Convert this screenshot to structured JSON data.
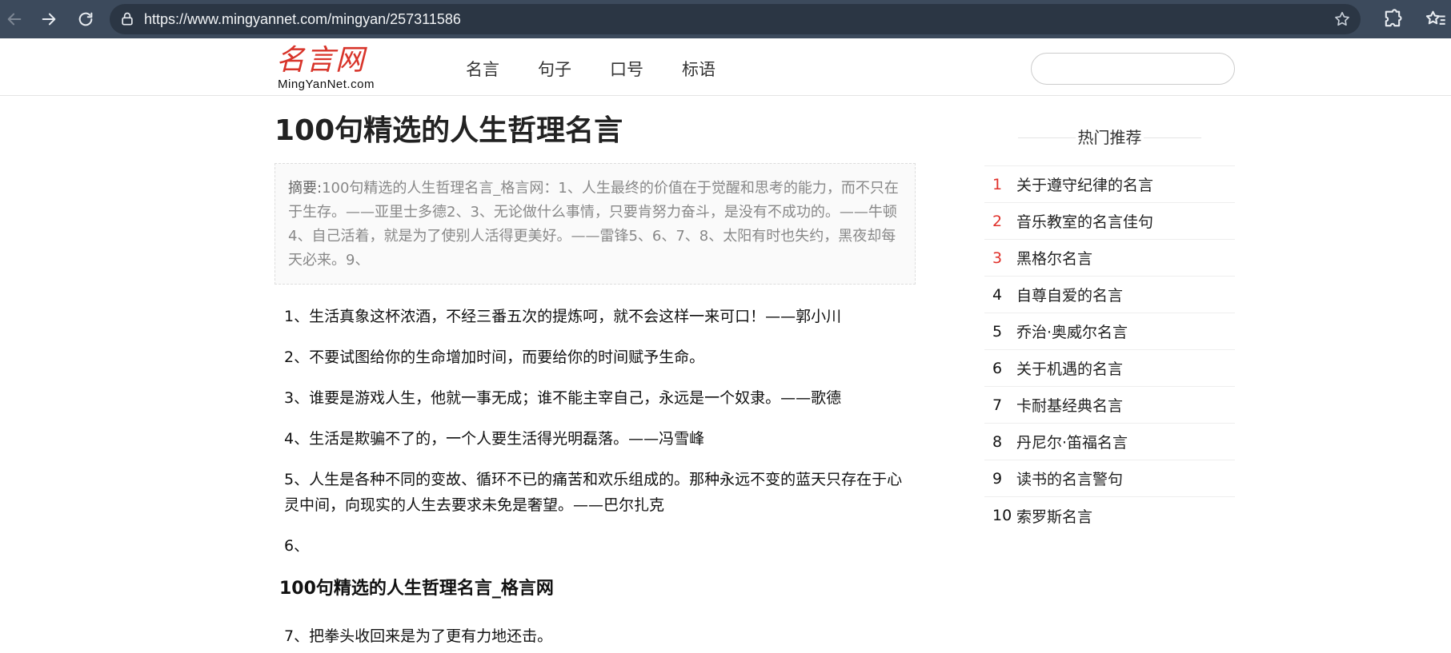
{
  "browser": {
    "url": "https://www.mingyannet.com/mingyan/257311586"
  },
  "site": {
    "logo_cn": "名言网",
    "logo_en": "MingYanNet.com",
    "nav": [
      "名言",
      "句子",
      "口号",
      "标语"
    ],
    "search_placeholder": ""
  },
  "article": {
    "title": "100句精选的人生哲理名言",
    "summary_label": "摘要:",
    "summary_text": "100句精选的人生哲理名言_格言网：1、人生最终的价值在于觉醒和思考的能力，而不只在于生存。——亚里士多德2、3、无论做什么事情，只要肯努力奋斗，是没有不成功的。——牛顿4、自己活着，就是为了使别人活得更美好。——雷锋5、6、7、8、太阳有时也失约，黑夜却每天必来。9、",
    "paragraphs": [
      "1、生活真象这杯浓酒，不经三番五次的提炼呵，就不会这样一来可口！——郭小川",
      "2、不要试图给你的生命增加时间，而要给你的时间赋予生命。",
      "3、谁要是游戏人生，他就一事无成；谁不能主宰自己，永远是一个奴隶。——歌德",
      "4、生活是欺骗不了的，一个人要生活得光明磊落。——冯雪峰",
      "5、人生是各种不同的变故、循环不已的痛苦和欢乐组成的。那种永远不变的蓝天只存在于心灵中间，向现实的人生去要求未免是奢望。——巴尔扎克",
      "6、"
    ],
    "subheading": "100句精选的人生哲理名言_格言网",
    "paragraphs_after": [
      "7、把拳头收回来是为了更有力地还击。"
    ]
  },
  "sidebar": {
    "title": "热门推荐",
    "items": [
      {
        "num": "1",
        "text": "关于遵守纪律的名言",
        "hot": true
      },
      {
        "num": "2",
        "text": "音乐教室的名言佳句",
        "hot": true
      },
      {
        "num": "3",
        "text": "黑格尔名言",
        "hot": true
      },
      {
        "num": "4",
        "text": "自尊自爱的名言",
        "hot": false
      },
      {
        "num": "5",
        "text": "乔治·奥威尔名言",
        "hot": false
      },
      {
        "num": "6",
        "text": "关于机遇的名言",
        "hot": false
      },
      {
        "num": "7",
        "text": "卡耐基经典名言",
        "hot": false
      },
      {
        "num": "8",
        "text": "丹尼尔·笛福名言",
        "hot": false
      },
      {
        "num": "9",
        "text": "读书的名言警句",
        "hot": false
      },
      {
        "num": "10",
        "text": "索罗斯名言",
        "hot": false
      }
    ],
    "hot_color": "#e0302a"
  },
  "icons": {
    "back": "arrow-left-icon",
    "forward": "arrow-right-icon",
    "reload": "reload-icon",
    "site_info": "lock-icon",
    "bookmark": "star-icon",
    "extensions": "puzzle-icon",
    "favorites": "favorites-icon"
  }
}
